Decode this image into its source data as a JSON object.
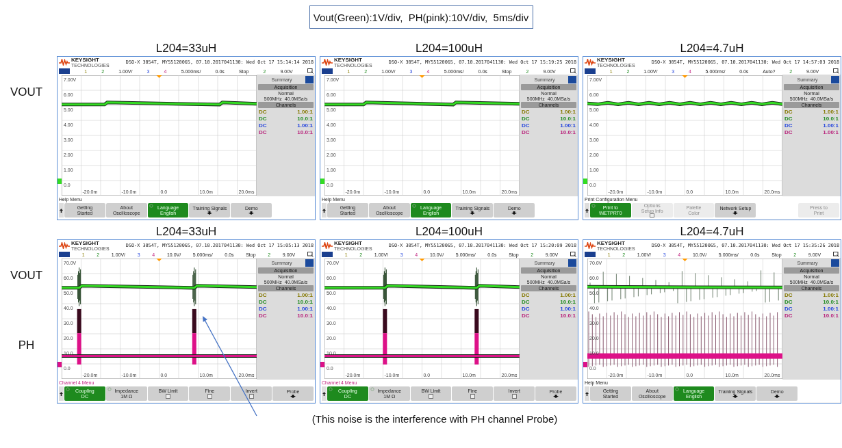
{
  "scale_note": "Vout(Green):1V/div,  PH(pink):10V/div,  5ms/div",
  "rows": [
    {
      "signal_labels": [
        {
          "text": "VOUT",
          "kind": "vout"
        }
      ],
      "panels": [
        {
          "title": "L204=33uH",
          "brand": "KEYSIGHT",
          "brand_sub": "TECHNOLOGIES",
          "info": "DSO-X 3054T, MY55120065, 07.10.2017041130: Wed Oct 17 15:14:14 2018",
          "channel_bar": [
            {
              "text": "1",
              "kind": "ch1"
            },
            {
              "text": "2",
              "kind": "ch2"
            },
            {
              "text": "1.00V/",
              "kind": "plain"
            },
            {
              "text": "3",
              "kind": "ch3"
            },
            {
              "text": "4",
              "kind": "ch4"
            },
            {
              "text": "5.000ms/",
              "kind": "plain"
            },
            {
              "text": "0.0s",
              "kind": "plain"
            },
            {
              "text": "Stop",
              "kind": "plain"
            },
            {
              "text": "2",
              "kind": "ch2"
            },
            {
              "text": "9.00V",
              "kind": "plain"
            }
          ],
          "y_labels": [
            "7.00V",
            "6.00",
            "5.00",
            "4.00",
            "3.00",
            "2.00",
            "1.00",
            "0.0"
          ],
          "x_labels": [
            "-20.0m",
            "-10.0m",
            "0.0",
            "10.0m",
            "20.0ms"
          ],
          "traces": [
            {
              "kind": "steps",
              "color": "#33dd22"
            }
          ],
          "side_panel": {
            "tab": "Summary",
            "acquisition": "Acquisition",
            "mode": "Normal",
            "rate": "500MHz  40.0MSa/s",
            "channels_heading": "Channels",
            "channels": [
              {
                "coupling": "DC",
                "probe": "1.00:1",
                "color": "#857800"
              },
              {
                "coupling": "DC",
                "probe": "10.0:1",
                "color": "#1f8a1f"
              },
              {
                "coupling": "DC",
                "probe": "1.00:1",
                "color": "#2244dd"
              },
              {
                "coupling": "DC",
                "probe": "10.0:1",
                "color": "#b8207a"
              }
            ]
          },
          "menu": {
            "title": "Help Menu",
            "kind": "help"
          },
          "softkeys": [
            {
              "kind": "normal",
              "lines": [
                "Getting",
                "Started"
              ]
            },
            {
              "kind": "normal",
              "lines": [
                "About",
                "Oscilloscope"
              ]
            },
            {
              "kind": "active",
              "dial": true,
              "lines": [
                "Language",
                "English"
              ]
            },
            {
              "kind": "normal",
              "submenu": true,
              "lines": [
                "Training Signals"
              ]
            },
            {
              "kind": "normal",
              "submenu": true,
              "lines": [
                "Demo"
              ]
            },
            {
              "kind": "empty"
            }
          ]
        },
        {
          "title": "L204=100uH",
          "brand": "KEYSIGHT",
          "brand_sub": "TECHNOLOGIES",
          "info": "DSO-X 3054T, MY55120065, 07.10.2017041130: Wed Oct 17 15:19:25 2018",
          "channel_bar": [
            {
              "text": "1",
              "kind": "ch1"
            },
            {
              "text": "2",
              "kind": "ch2"
            },
            {
              "text": "1.00V/",
              "kind": "plain"
            },
            {
              "text": "3",
              "kind": "ch3"
            },
            {
              "text": "4",
              "kind": "ch4"
            },
            {
              "text": "5.000ms/",
              "kind": "plain"
            },
            {
              "text": "0.0s",
              "kind": "plain"
            },
            {
              "text": "Stop",
              "kind": "plain"
            },
            {
              "text": "2",
              "kind": "ch2"
            },
            {
              "text": "9.00V",
              "kind": "plain"
            }
          ],
          "y_labels": [
            "7.00V",
            "6.00",
            "5.00",
            "4.00",
            "3.00",
            "2.00",
            "1.00",
            "0.0"
          ],
          "x_labels": [
            "-20.0m",
            "-10.0m",
            "0.0",
            "10.0m",
            "20.0ms"
          ],
          "traces": [
            {
              "kind": "steps",
              "color": "#33dd22"
            }
          ],
          "side_panel": {
            "tab": "Summary",
            "acquisition": "Acquisition",
            "mode": "Normal",
            "rate": "500MHz  40.0MSa/s",
            "channels_heading": "Channels",
            "channels": [
              {
                "coupling": "DC",
                "probe": "1.00:1",
                "color": "#857800"
              },
              {
                "coupling": "DC",
                "probe": "10.0:1",
                "color": "#1f8a1f"
              },
              {
                "coupling": "DC",
                "probe": "1.00:1",
                "color": "#2244dd"
              },
              {
                "coupling": "DC",
                "probe": "10.0:1",
                "color": "#b8207a"
              }
            ]
          },
          "menu": {
            "title": "Help Menu",
            "kind": "help"
          },
          "softkeys": [
            {
              "kind": "normal",
              "lines": [
                "Getting",
                "Started"
              ]
            },
            {
              "kind": "normal",
              "lines": [
                "About",
                "Oscilloscope"
              ]
            },
            {
              "kind": "active",
              "dial": true,
              "lines": [
                "Language",
                "English"
              ]
            },
            {
              "kind": "normal",
              "submenu": true,
              "lines": [
                "Training Signals"
              ]
            },
            {
              "kind": "normal",
              "submenu": true,
              "lines": [
                "Demo"
              ]
            },
            {
              "kind": "empty"
            }
          ]
        },
        {
          "title": "L204=4.7uH",
          "brand": "KEYSIGHT",
          "brand_sub": "TECHNOLOGIES",
          "info": "DSO-X 3054T, MY55120065, 07.10.2017041130: Wed Oct 17 14:57:03 2018",
          "channel_bar": [
            {
              "text": "1",
              "kind": "ch1"
            },
            {
              "text": "2",
              "kind": "ch2"
            },
            {
              "text": "1.00V/",
              "kind": "plain"
            },
            {
              "text": "3",
              "kind": "ch3"
            },
            {
              "text": "4",
              "kind": "ch4"
            },
            {
              "text": "5.000ms/",
              "kind": "plain"
            },
            {
              "text": "0.0s",
              "kind": "plain"
            },
            {
              "text": "Auto?",
              "kind": "plain"
            },
            {
              "text": "2",
              "kind": "ch2"
            },
            {
              "text": "9.00V",
              "kind": "plain"
            }
          ],
          "y_labels": [
            "7.00V",
            "6.00",
            "5.00",
            "4.00",
            "3.00",
            "2.00",
            "1.00",
            "0.0"
          ],
          "x_labels": [
            "-20.0m",
            "-10.0m",
            "0.0",
            "10.0m",
            "20.0ms"
          ],
          "traces": [
            {
              "kind": "flat",
              "color": "#33dd22"
            }
          ],
          "side_panel": {
            "tab": "Summary",
            "acquisition": "Acquisition",
            "mode": "Normal",
            "rate": "500MHz  40.0MSa/s",
            "channels_heading": "Channels",
            "channels": [
              {
                "coupling": "DC",
                "probe": "1.00:1",
                "color": "#857800"
              },
              {
                "coupling": "DC",
                "probe": "10.0:1",
                "color": "#1f8a1f"
              },
              {
                "coupling": "DC",
                "probe": "1.00:1",
                "color": "#2244dd"
              },
              {
                "coupling": "DC",
                "probe": "1.00:1",
                "color": "#b8207a"
              }
            ]
          },
          "menu": {
            "title": "Print Configuration Menu",
            "kind": "help"
          },
          "softkeys": [
            {
              "kind": "active",
              "dial": true,
              "lines": [
                "Print to",
                "\\NETPRT0"
              ]
            },
            {
              "kind": "disabled",
              "checked": false,
              "lines": [
                "Options",
                "Setup Info"
              ]
            },
            {
              "kind": "disabled",
              "lines": [
                "Palette",
                "Color"
              ]
            },
            {
              "kind": "normal",
              "submenu": true,
              "lines": [
                "Network Setup"
              ]
            },
            {
              "kind": "empty"
            },
            {
              "kind": "disabled",
              "lines": [
                "Press to",
                "Print"
              ]
            }
          ]
        }
      ]
    },
    {
      "signal_labels": [
        {
          "text": "VOUT",
          "kind": "vout"
        },
        {
          "text": "PH",
          "kind": "ph"
        }
      ],
      "panels": [
        {
          "title": "L204=33uH",
          "brand": "KEYSIGHT",
          "brand_sub": "TECHNOLOGIES",
          "info": "DSO-X 3054T, MY55120065, 07.10.2017041130: Wed Oct 17 15:05:13 2018",
          "channel_bar": [
            {
              "text": "1",
              "kind": "ch1"
            },
            {
              "text": "2",
              "kind": "ch2"
            },
            {
              "text": "1.00V/",
              "kind": "plain"
            },
            {
              "text": "3",
              "kind": "ch3"
            },
            {
              "text": "4",
              "kind": "ch4"
            },
            {
              "text": "10.0V/",
              "kind": "plain"
            },
            {
              "text": "5.000ms/",
              "kind": "plain"
            },
            {
              "text": "0.0s",
              "kind": "plain"
            },
            {
              "text": "Stop",
              "kind": "plain"
            },
            {
              "text": "2",
              "kind": "ch2"
            },
            {
              "text": "9.00V",
              "kind": "plain"
            }
          ],
          "y_labels": [
            "70.0V",
            "60.0",
            "50.0",
            "40.0",
            "30.0",
            "20.0",
            "10.0",
            "0.0"
          ],
          "x_labels": [
            "-20.0m",
            "-10.0m",
            "0.0",
            "10.0m",
            "20.0ms"
          ],
          "traces": [
            {
              "kind": "bursts",
              "color": "#33dd22"
            },
            {
              "kind": "pulses",
              "color": "#dd1188"
            }
          ],
          "side_panel": {
            "tab": "Summary",
            "acquisition": "Acquisition",
            "mode": "Normal",
            "rate": "500MHz  40.0MSa/s",
            "channels_heading": "Channels",
            "channels": [
              {
                "coupling": "DC",
                "probe": "1.00:1",
                "color": "#857800"
              },
              {
                "coupling": "DC",
                "probe": "10.0:1",
                "color": "#1f8a1f"
              },
              {
                "coupling": "DC",
                "probe": "1.00:1",
                "color": "#2244dd"
              },
              {
                "coupling": "DC",
                "probe": "10.0:1",
                "color": "#b8207a"
              }
            ]
          },
          "menu": {
            "title": "Channel 4 Menu",
            "kind": "channel"
          },
          "softkeys": [
            {
              "kind": "active",
              "dial": true,
              "lines": [
                "Coupling",
                "DC"
              ]
            },
            {
              "kind": "normal",
              "dial": true,
              "lines": [
                "Impedance",
                "1M Ω"
              ]
            },
            {
              "kind": "normal",
              "checked": false,
              "lines": [
                "BW Limit"
              ]
            },
            {
              "kind": "normal",
              "checked": false,
              "lines": [
                "Fine"
              ]
            },
            {
              "kind": "normal",
              "checked": false,
              "lines": [
                "Invert"
              ]
            },
            {
              "kind": "normal",
              "submenu": true,
              "lines": [
                "Probe"
              ]
            }
          ]
        },
        {
          "title": "L204=100uH",
          "brand": "KEYSIGHT",
          "brand_sub": "TECHNOLOGIES",
          "info": "DSO-X 3054T, MY55120065, 07.10.2017041130: Wed Oct 17 15:20:09 2018",
          "channel_bar": [
            {
              "text": "1",
              "kind": "ch1"
            },
            {
              "text": "2",
              "kind": "ch2"
            },
            {
              "text": "1.00V/",
              "kind": "plain"
            },
            {
              "text": "3",
              "kind": "ch3"
            },
            {
              "text": "4",
              "kind": "ch4"
            },
            {
              "text": "10.0V/",
              "kind": "plain"
            },
            {
              "text": "5.000ms/",
              "kind": "plain"
            },
            {
              "text": "0.0s",
              "kind": "plain"
            },
            {
              "text": "Stop",
              "kind": "plain"
            },
            {
              "text": "2",
              "kind": "ch2"
            },
            {
              "text": "9.00V",
              "kind": "plain"
            }
          ],
          "y_labels": [
            "70.0V",
            "60.0",
            "50.0",
            "40.0",
            "30.0",
            "20.0",
            "10.0",
            "0.0"
          ],
          "x_labels": [
            "-20.0m",
            "-10.0m",
            "0.0",
            "10.0m",
            "20.0ms"
          ],
          "traces": [
            {
              "kind": "bursts",
              "color": "#33dd22"
            },
            {
              "kind": "pulses",
              "color": "#dd1188"
            }
          ],
          "side_panel": {
            "tab": "Summary",
            "acquisition": "Acquisition",
            "mode": "Normal",
            "rate": "500MHz  40.0MSa/s",
            "channels_heading": "Channels",
            "channels": [
              {
                "coupling": "DC",
                "probe": "1.00:1",
                "color": "#857800"
              },
              {
                "coupling": "DC",
                "probe": "10.0:1",
                "color": "#1f8a1f"
              },
              {
                "coupling": "DC",
                "probe": "1.00:1",
                "color": "#2244dd"
              },
              {
                "coupling": "DC",
                "probe": "10.0:1",
                "color": "#b8207a"
              }
            ]
          },
          "menu": {
            "title": "Channel 4 Menu",
            "kind": "channel"
          },
          "softkeys": [
            {
              "kind": "active",
              "dial": true,
              "lines": [
                "Coupling",
                "DC"
              ]
            },
            {
              "kind": "normal",
              "dial": true,
              "lines": [
                "Impedance",
                "1M Ω"
              ]
            },
            {
              "kind": "normal",
              "checked": false,
              "lines": [
                "BW Limit"
              ]
            },
            {
              "kind": "normal",
              "checked": false,
              "lines": [
                "Fine"
              ]
            },
            {
              "kind": "normal",
              "checked": false,
              "lines": [
                "Invert"
              ]
            },
            {
              "kind": "normal",
              "submenu": true,
              "lines": [
                "Probe"
              ]
            }
          ]
        },
        {
          "title": "L204=4.7uH",
          "brand": "KEYSIGHT",
          "brand_sub": "TECHNOLOGIES",
          "info": "DSO-X 3054T, MY55120065, 07.10.2017041130: Wed Oct 17 15:35:26 2018",
          "channel_bar": [
            {
              "text": "1",
              "kind": "ch1"
            },
            {
              "text": "2",
              "kind": "ch2"
            },
            {
              "text": "1.00V/",
              "kind": "plain"
            },
            {
              "text": "3",
              "kind": "ch3"
            },
            {
              "text": "4",
              "kind": "ch4"
            },
            {
              "text": "10.0V/",
              "kind": "plain"
            },
            {
              "text": "5.000ms/",
              "kind": "plain"
            },
            {
              "text": "0.0s",
              "kind": "plain"
            },
            {
              "text": "Stop",
              "kind": "plain"
            },
            {
              "text": "2",
              "kind": "ch2"
            },
            {
              "text": "9.00V",
              "kind": "plain"
            }
          ],
          "y_labels": [
            "70.0V",
            "60.0",
            "50.0",
            "40.0",
            "30.0",
            "20.0",
            "10.0",
            "0.0"
          ],
          "x_labels": [
            "-20.0m",
            "-10.0m",
            "0.0",
            "10.0m",
            "20.0ms"
          ],
          "traces": [
            {
              "kind": "spikes",
              "color": "#33dd22"
            },
            {
              "kind": "switching",
              "color": "#dd1188"
            }
          ],
          "side_panel": {
            "tab": "Summary",
            "acquisition": "Acquisition",
            "mode": "Normal",
            "rate": "500MHz  40.0MSa/s",
            "channels_heading": "Channels",
            "channels": [
              {
                "coupling": "DC",
                "probe": "1.00:1",
                "color": "#857800"
              },
              {
                "coupling": "DC",
                "probe": "10.0:1",
                "color": "#1f8a1f"
              },
              {
                "coupling": "DC",
                "probe": "1.00:1",
                "color": "#2244dd"
              },
              {
                "coupling": "DC",
                "probe": "10.0:1",
                "color": "#b8207a"
              }
            ]
          },
          "menu": {
            "title": "Help Menu",
            "kind": "help"
          },
          "softkeys": [
            {
              "kind": "normal",
              "lines": [
                "Getting",
                "Started"
              ]
            },
            {
              "kind": "normal",
              "lines": [
                "About",
                "Oscilloscope"
              ]
            },
            {
              "kind": "active",
              "dial": true,
              "lines": [
                "Language",
                "English"
              ]
            },
            {
              "kind": "normal",
              "submenu": true,
              "lines": [
                "Training Signals"
              ]
            },
            {
              "kind": "normal",
              "submenu": true,
              "lines": [
                "Demo"
              ]
            },
            {
              "kind": "empty"
            }
          ]
        }
      ]
    }
  ],
  "caption": "(This noise is the interference with PH channel Probe)"
}
